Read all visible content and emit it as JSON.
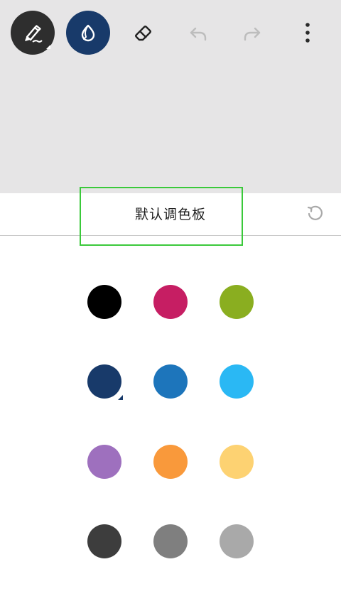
{
  "toolbar": {
    "tools": [
      {
        "name": "pen-tool",
        "icon": "pen-icon",
        "active": true
      },
      {
        "name": "dropper-tool",
        "icon": "ink-drop-icon",
        "active": true
      },
      {
        "name": "eraser-tool",
        "icon": "eraser-icon"
      },
      {
        "name": "undo-tool",
        "icon": "undo-arrow-icon",
        "disabled": true
      },
      {
        "name": "redo-tool",
        "icon": "redo-arrow-icon",
        "disabled": true
      },
      {
        "name": "more-tool",
        "icon": "more-vertical-icon"
      }
    ]
  },
  "palette": {
    "title": "默认调色板",
    "reset_icon": "reset-icon",
    "selected_index": 3,
    "colors": [
      {
        "name": "black",
        "hex": "#000000"
      },
      {
        "name": "magenta",
        "hex": "#c61e63"
      },
      {
        "name": "olive-green",
        "hex": "#8aae20"
      },
      {
        "name": "navy",
        "hex": "#183a6a"
      },
      {
        "name": "blue",
        "hex": "#1d75bb"
      },
      {
        "name": "sky-blue",
        "hex": "#2ab8f4"
      },
      {
        "name": "purple",
        "hex": "#9e70be"
      },
      {
        "name": "orange",
        "hex": "#f9993b"
      },
      {
        "name": "yellow",
        "hex": "#fdd272"
      },
      {
        "name": "dark-gray",
        "hex": "#3d3d3d"
      },
      {
        "name": "gray",
        "hex": "#7f7f7f"
      },
      {
        "name": "light-gray",
        "hex": "#a9a9a9"
      }
    ]
  }
}
